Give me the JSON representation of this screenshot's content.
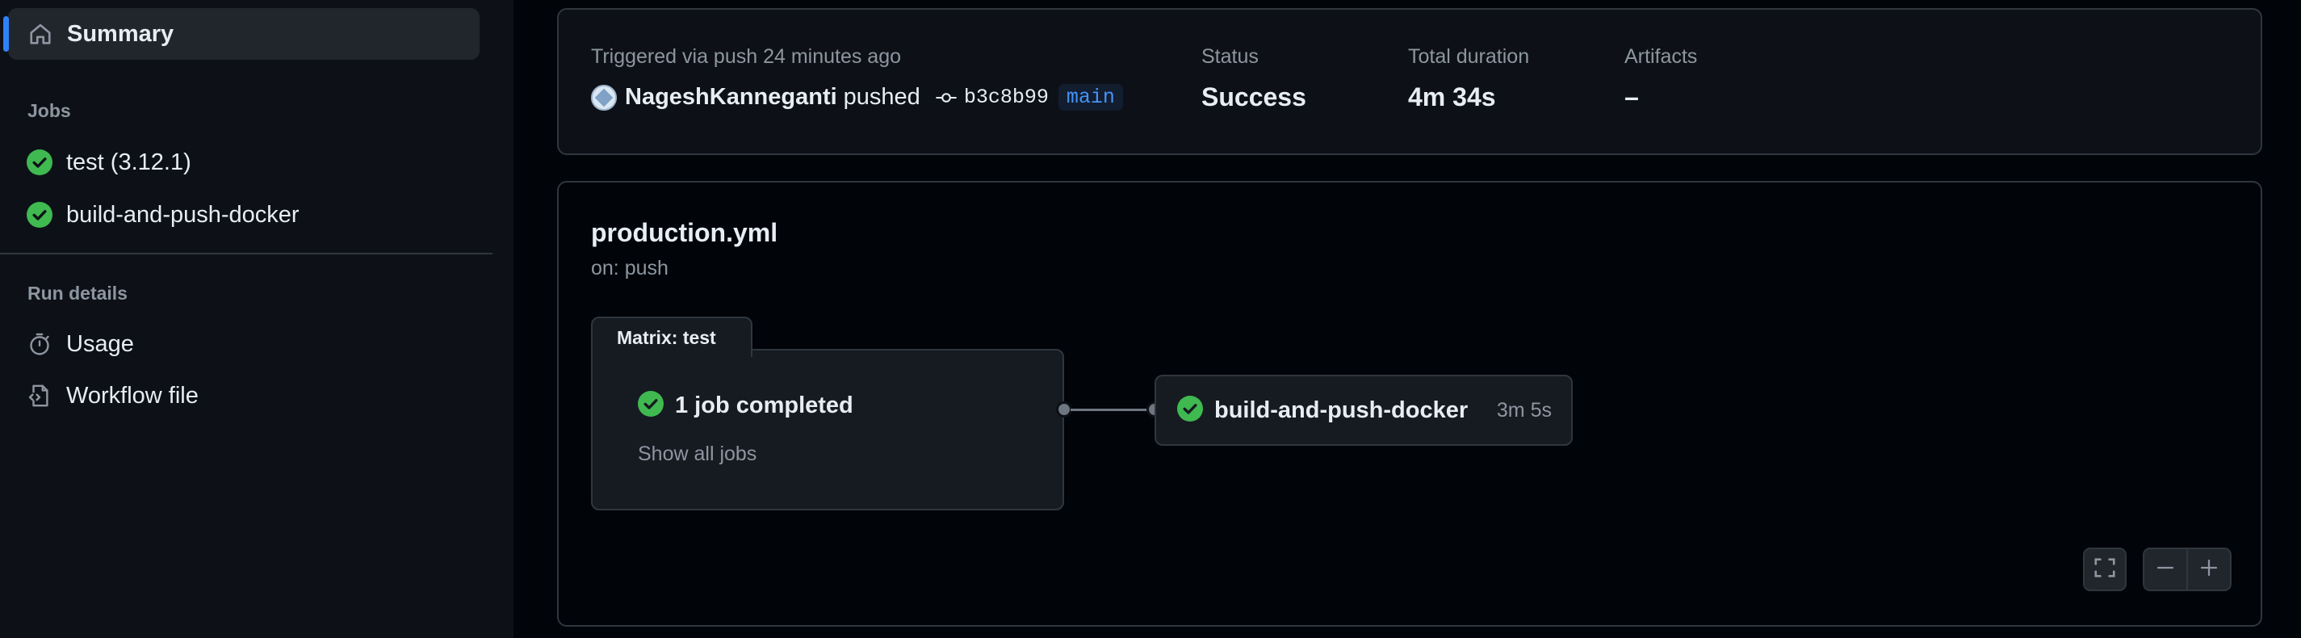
{
  "sidebar": {
    "summary": {
      "label": "Summary",
      "icon": "home-icon"
    },
    "jobs_heading": "Jobs",
    "jobs": [
      {
        "label": "test (3.12.1)",
        "status": "success",
        "icon": "check-circle-icon"
      },
      {
        "label": "build-and-push-docker",
        "status": "success",
        "icon": "check-circle-icon"
      }
    ],
    "run_details_heading": "Run details",
    "run_details": [
      {
        "label": "Usage",
        "icon": "stopwatch-icon"
      },
      {
        "label": "Workflow file",
        "icon": "file-code-icon"
      }
    ]
  },
  "run_summary": {
    "trigger_text": "Triggered via push 24 minutes ago",
    "actor": "NageshKanneganti",
    "action": "pushed",
    "commit_sha": "b3c8b99",
    "branch": "main",
    "status_label": "Status",
    "status_value": "Success",
    "duration_label": "Total duration",
    "duration_value": "4m 34s",
    "artifacts_label": "Artifacts",
    "artifacts_value": "–"
  },
  "workflow": {
    "file": "production.yml",
    "trigger": "on: push",
    "matrix": {
      "label": "Matrix: test",
      "summary": "1 job completed",
      "show_all": "Show all jobs"
    },
    "jobs": [
      {
        "name": "build-and-push-docker",
        "duration": "3m 5s",
        "status": "success"
      }
    ]
  },
  "graph_controls": {
    "fullscreen_icon": "fullscreen-icon",
    "zoom_out_icon": "minus-icon",
    "zoom_in_icon": "plus-icon"
  },
  "colors": {
    "success": "#3fb950",
    "accent": "#2f81f7",
    "branch_text": "#4493f8"
  }
}
